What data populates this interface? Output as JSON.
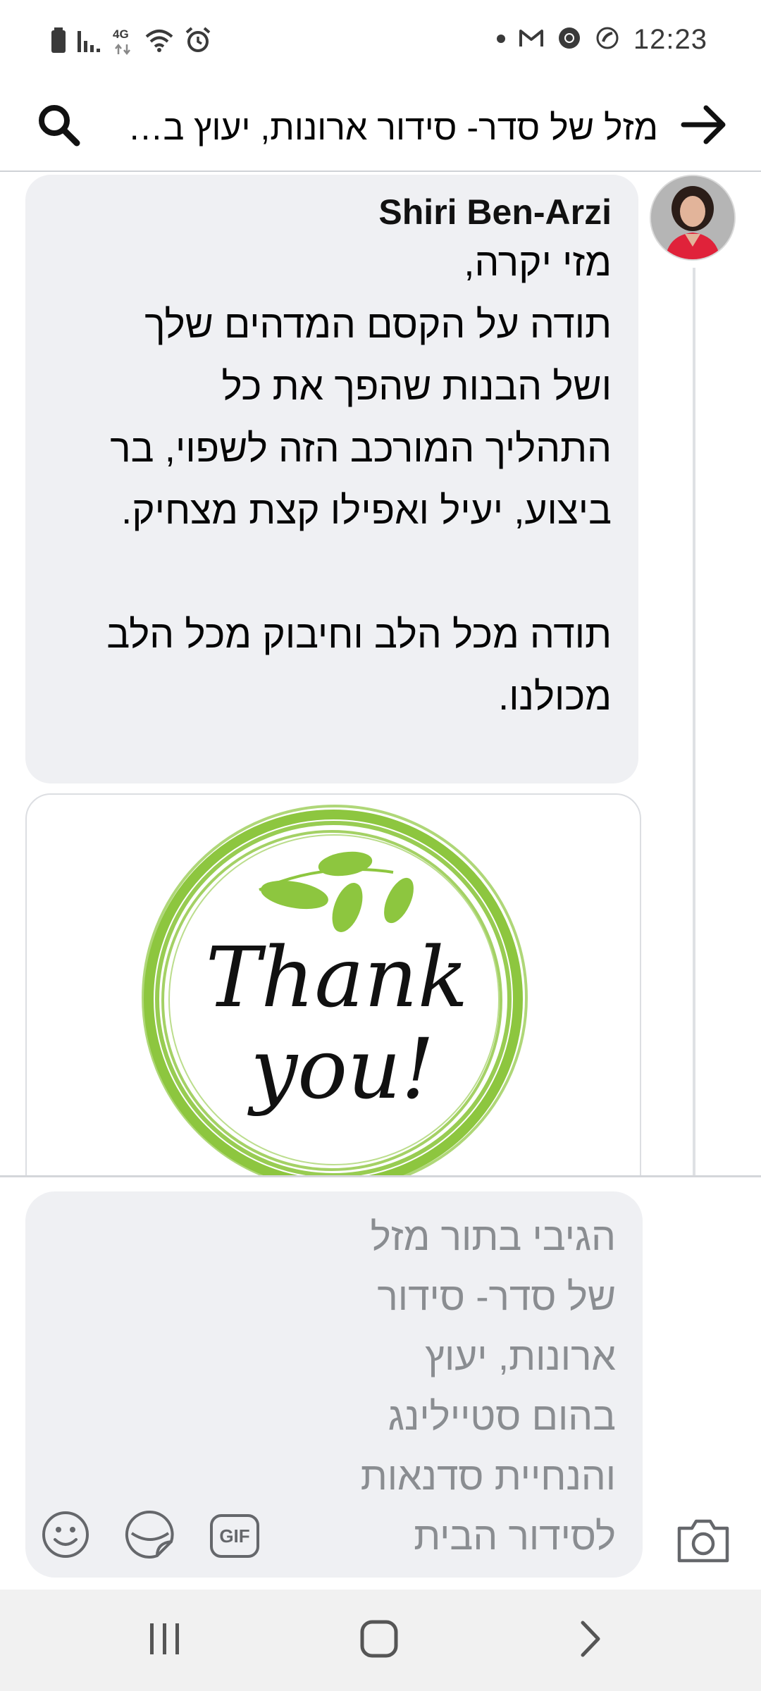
{
  "status_bar": {
    "time": "12:23",
    "network_label": "4G",
    "icons_left": [
      "battery-icon",
      "signal-icon",
      "data-arrows-icon",
      "wifi-icon",
      "alarm-icon"
    ],
    "icons_right": [
      "notification-dot-icon",
      "gmail-icon",
      "chrome-icon",
      "phone-icon"
    ]
  },
  "header": {
    "title": "מזל של סדר- סידור ארונות, יעוץ בהום סטיילינג והנחיית סדנאות לסידור הבית",
    "back_icon": "arrow-right-icon",
    "search_icon": "search-icon"
  },
  "comment": {
    "author": "Shiri Ben-Arzi",
    "text": "מזי יקרה,\nתודה על הקסם המדהים שלך\nושל הבנות שהפך את כל\nהתהליך המורכב הזה לשפוי, בר\nביצוע, יעיל ואפילו קצת מצחיק.\n\nתודה מכל הלב וחיבוק מכל הלב\nמכולנו.",
    "image": {
      "text_line1": "Thank",
      "text_line2": "you!",
      "ring_color": "#8dc63f",
      "leaf_color": "#8dc63f"
    }
  },
  "composer": {
    "placeholder": "הגיבי בתור מזל\nשל סדר- סידור\nארונות, יעוץ\nבהום סטיילינג\nוהנחיית סדנאות\nלסידור הבית",
    "gif_label": "GIF",
    "icons": [
      "emoji-icon",
      "sticker-icon",
      "gif-icon",
      "camera-icon"
    ]
  },
  "navbar": {
    "icons": [
      "recent-apps-icon",
      "home-icon",
      "back-icon"
    ]
  },
  "colors": {
    "bubble_bg": "#eff0f3",
    "placeholder_text": "#8a8d91",
    "divider": "#cfd2d6"
  }
}
